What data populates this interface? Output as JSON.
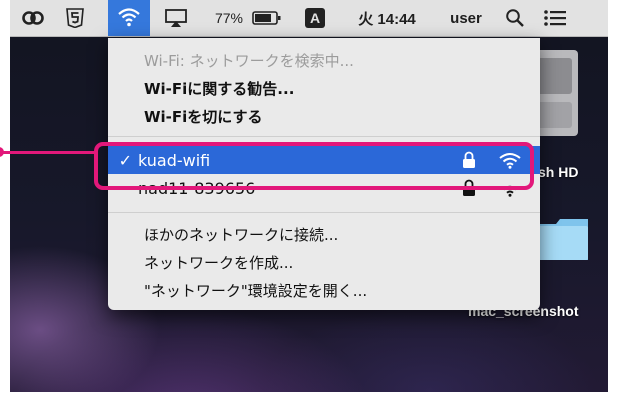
{
  "menubar": {
    "battery_percent": "77%",
    "input_source": "A",
    "clock": "火 14:44",
    "user": "user",
    "icons": [
      "creative-cloud-icon",
      "html5-icon",
      "wifi-icon",
      "airplay-icon",
      "battery-icon",
      "input-source-icon",
      "spotlight-search-icon",
      "notification-center-icon"
    ],
    "wifi_tile_color": "#3578dc"
  },
  "wifi_menu": {
    "searching": "Wi-Fi: ネットワークを検索中...",
    "recommendations": "Wi-Fiに関する勧告...",
    "turn_off": "Wi-Fiを切にする",
    "networks": [
      {
        "name": "kuad-wifi",
        "selected": true,
        "locked": true,
        "check": "✓"
      },
      {
        "name": "nad11-839656",
        "selected": false,
        "locked": true
      }
    ],
    "join_other": "ほかのネットワークに接続...",
    "create_network": "ネットワークを作成...",
    "open_prefs": "\"ネットワーク\"環境設定を開く...",
    "selection_color": "#2b68d8"
  },
  "desktop": {
    "hd_label": "sh HD",
    "folder_label": "mac_screenshot"
  },
  "annotation": {
    "color": "#e2187a"
  }
}
